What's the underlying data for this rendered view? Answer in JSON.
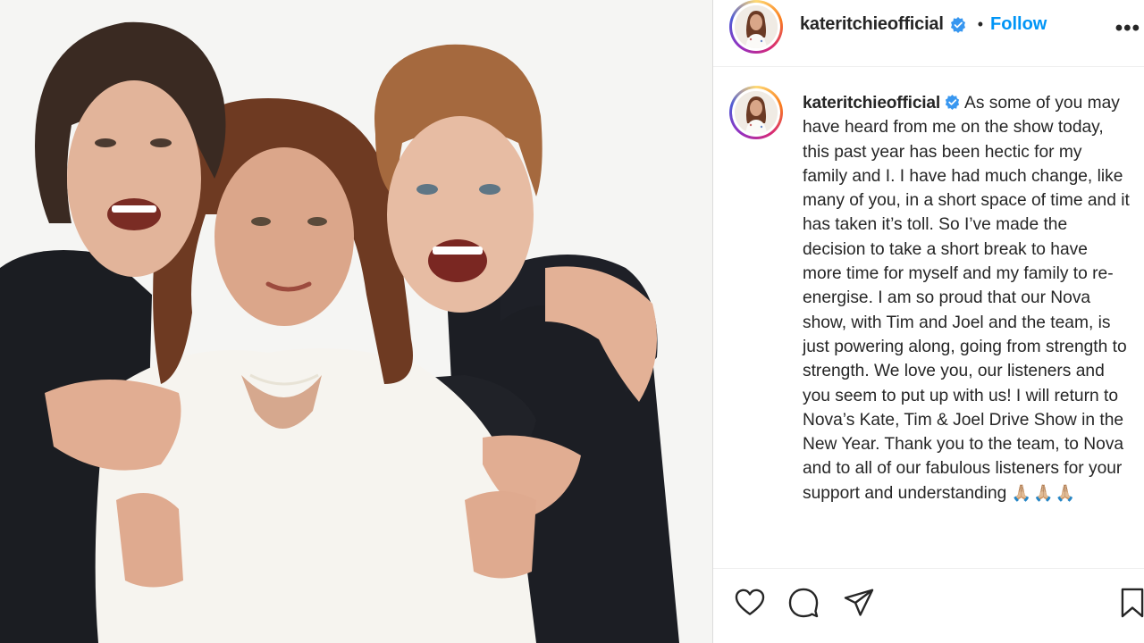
{
  "post": {
    "username": "kateritchieofficial",
    "follow_label": "Follow",
    "separator": "•",
    "more_label": "•••"
  },
  "caption": {
    "username": "kateritchieofficial",
    "text": "As some of you may have heard from me on the show today, this past year has been hectic for my family and I. I have had much change, like many of you, in a short space of time and it has taken it’s toll. So I’ve made the decision to take a short break to have more time for myself and my family to re-energise. I am so proud that our Nova show, with Tim and Joel and the team, is just powering along, going from strength to strength. We love you, our listeners and you seem to put up with us! I will return to Nova’s Kate, Tim & Joel Drive Show in the New Year. Thank you to the team, to Nova and to all of our fabulous listeners for your support and understanding",
    "emoji": "🙏🏼🙏🏼🙏🏼"
  },
  "colors": {
    "accent": "#0095f6",
    "verified": "#3897f0",
    "text": "#262626"
  },
  "icons": {
    "verified": "verified-badge-icon",
    "like": "heart-icon",
    "comment": "comment-bubble-icon",
    "share": "paper-plane-icon",
    "save": "bookmark-icon",
    "more": "more-options-icon"
  }
}
